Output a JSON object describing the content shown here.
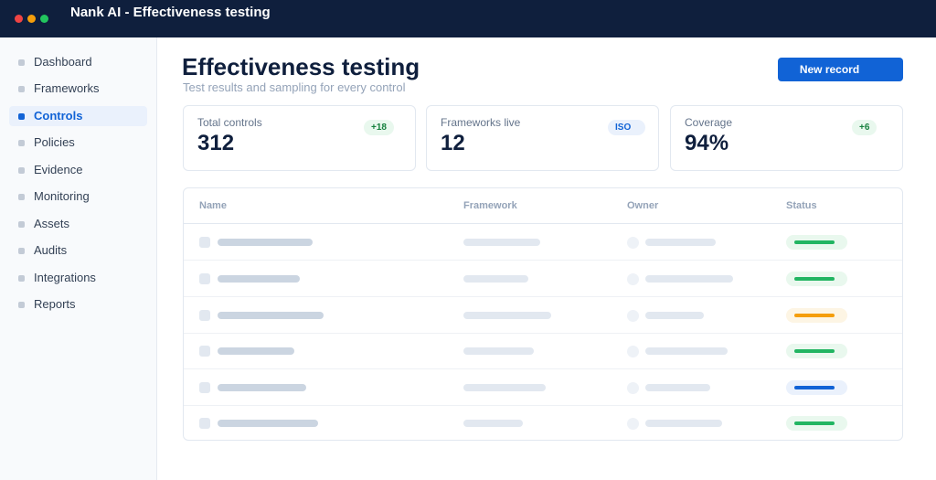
{
  "window": {
    "title": "Nank AI  -  Effectiveness testing"
  },
  "sidebar": {
    "items": [
      {
        "label": "Dashboard",
        "active": false
      },
      {
        "label": "Frameworks",
        "active": false
      },
      {
        "label": "Controls",
        "active": true
      },
      {
        "label": "Policies",
        "active": false
      },
      {
        "label": "Evidence",
        "active": false
      },
      {
        "label": "Monitoring",
        "active": false
      },
      {
        "label": "Assets",
        "active": false
      },
      {
        "label": "Audits",
        "active": false
      },
      {
        "label": "Integrations",
        "active": false
      },
      {
        "label": "Reports",
        "active": false
      }
    ]
  },
  "header": {
    "title": "Effectiveness testing",
    "subtitle": "Test results and sampling for every control",
    "primary_button": "New record"
  },
  "kpis": [
    {
      "label": "Total controls",
      "value": "312",
      "badge": "+18",
      "badge_tone": "green"
    },
    {
      "label": "Frameworks live",
      "value": "12",
      "badge": "ISO",
      "badge_tone": "blue"
    },
    {
      "label": "Coverage",
      "value": "94%",
      "badge": "+6",
      "badge_tone": "green"
    }
  ],
  "table": {
    "columns": [
      "Name",
      "Framework",
      "Owner",
      "Status"
    ],
    "rows": [
      {
        "status": "ok"
      },
      {
        "status": "ok"
      },
      {
        "status": "warn"
      },
      {
        "status": "ok"
      },
      {
        "status": "info"
      },
      {
        "status": "ok"
      }
    ]
  },
  "colors": {
    "titlebar": "#0f1f3d",
    "accent": "#1163d6",
    "status_ok": "#22b562",
    "status_warn": "#f59e0b",
    "status_info": "#1163d6"
  }
}
